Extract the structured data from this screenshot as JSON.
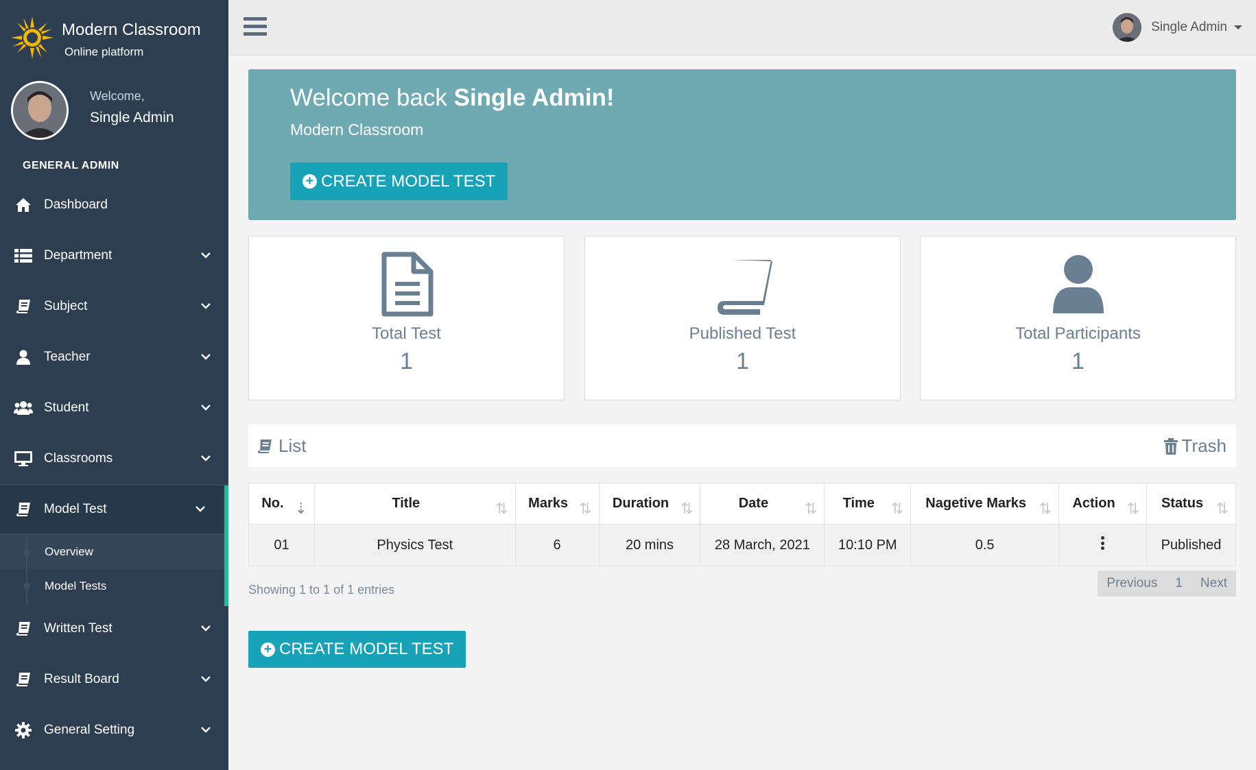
{
  "brand": {
    "name": "Modern Classroom",
    "tagline": "Online platform"
  },
  "profile": {
    "greeting": "Welcome,",
    "name": "Single Admin"
  },
  "sidebar": {
    "section_title": "GENERAL ADMIN",
    "items": [
      {
        "label": "Dashboard",
        "icon": "home-icon"
      },
      {
        "label": "Department",
        "icon": "list-icon"
      },
      {
        "label": "Subject",
        "icon": "book-icon"
      },
      {
        "label": "Teacher",
        "icon": "user-icon"
      },
      {
        "label": "Student",
        "icon": "users-icon"
      },
      {
        "label": "Classrooms",
        "icon": "desktop-icon"
      },
      {
        "label": "Model Test",
        "icon": "book-icon",
        "active": true
      },
      {
        "label": "Written Test",
        "icon": "book-icon"
      },
      {
        "label": "Result Board",
        "icon": "book-icon"
      },
      {
        "label": "General Setting",
        "icon": "gear-icon"
      }
    ],
    "sub_items": [
      {
        "label": "Overview",
        "active": true
      },
      {
        "label": "Model Tests"
      }
    ]
  },
  "topbar": {
    "user_name": "Single Admin"
  },
  "hero": {
    "title_prefix": "Welcome back ",
    "title_name": "Single Admin!",
    "subtitle": "Modern Classroom",
    "button_label": "CREATE MODEL TEST"
  },
  "cards": [
    {
      "label": "Total Test",
      "value": "1",
      "icon": "file-icon"
    },
    {
      "label": "Published Test",
      "value": "1",
      "icon": "book-icon"
    },
    {
      "label": "Total Participants",
      "value": "1",
      "icon": "user-icon"
    }
  ],
  "list": {
    "title": "List",
    "trash_label": "Trash",
    "columns": [
      "No.",
      "Title",
      "Marks",
      "Duration",
      "Date",
      "Time",
      "Nagetive Marks",
      "Action",
      "Status"
    ],
    "rows": [
      {
        "no": "01",
        "title": "Physics Test",
        "marks": "6",
        "duration": "20 mins",
        "date": "28 March, 2021",
        "time": "10:10 PM",
        "negative": "0.5",
        "status": "Published"
      }
    ],
    "info": "Showing 1 to 1 of 1 entries",
    "pagination": {
      "prev": "Previous",
      "page": "1",
      "next": "Next"
    }
  },
  "bottom_button_label": "CREATE MODEL TEST",
  "colors": {
    "sidebar": "#2d3e50",
    "hero": "#6fa9b2",
    "button": "#17a2b8",
    "active_indicator": "#1abc9c"
  }
}
